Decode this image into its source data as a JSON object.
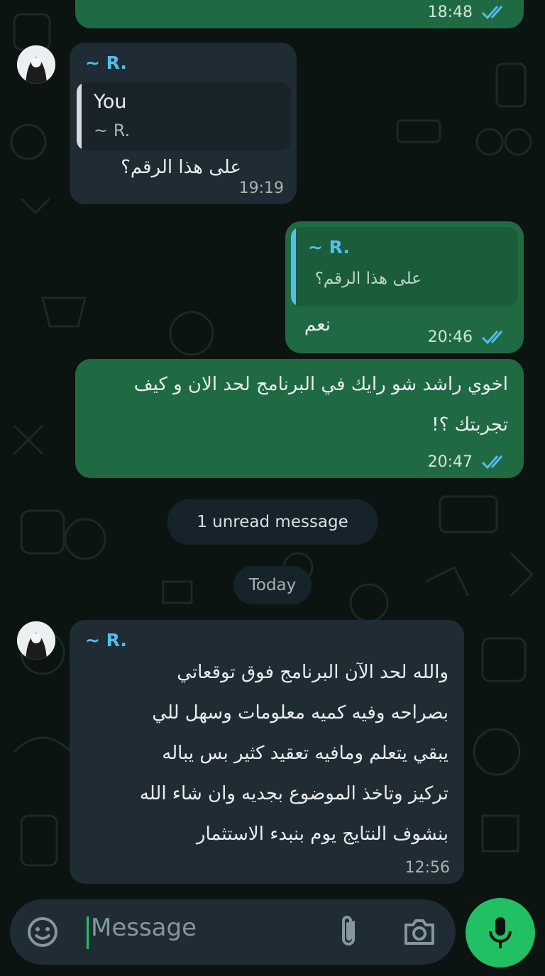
{
  "messages": [
    {
      "id": "m0",
      "direction": "outgoing",
      "time": "18:48",
      "status": "read"
    },
    {
      "id": "m1",
      "direction": "incoming",
      "sender": "~ R.",
      "reply_to": {
        "author": "You",
        "text": "~ R."
      },
      "text": "على هذا الرقم؟",
      "time": "19:19"
    },
    {
      "id": "m2",
      "direction": "outgoing",
      "reply_to": {
        "author": "~ R.",
        "text": "على هذا الرقم؟"
      },
      "text": "نعم",
      "time": "20:46",
      "status": "read"
    },
    {
      "id": "m3",
      "direction": "outgoing",
      "lines": [
        "اخوي راشد شو رايك في البرنامج لحد الان و كيف",
        "تجربتك ؟!"
      ],
      "time": "20:47",
      "status": "read"
    },
    {
      "id": "m4",
      "direction": "incoming",
      "sender": "~ R.",
      "lines": [
        "والله لحد الآن البرنامج فوق توقعاتي",
        "بصراحه وفيه كميه معلومات وسهل للي",
        "يبقي يتعلم ومافيه تعقيد كثير بس يباله",
        "تركيز وتاخذ الموضوع بجديه وان شاء الله",
        "بنشوف النتايج يوم بنبدء الاستثمار"
      ],
      "time": "12:56"
    }
  ],
  "unread_banner": "1 unread message",
  "date_divider": "Today",
  "composer": {
    "placeholder": "Message"
  },
  "icons": {
    "emoji": "emoji-icon",
    "attach": "paperclip-icon",
    "camera": "camera-icon",
    "mic": "microphone-icon",
    "ticks": "double-check-icon"
  },
  "colors": {
    "incoming_bubble": "#1f2c34",
    "outgoing_bubble": "#1f6a43",
    "accent": "#21c063",
    "sender": "#53bdeb",
    "tick": "#53bdeb"
  }
}
